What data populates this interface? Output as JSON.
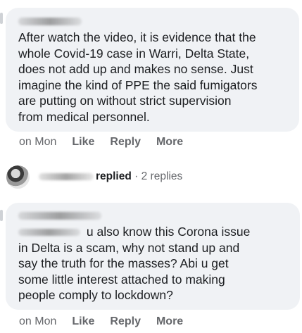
{
  "comment1": {
    "author": "N... Og...",
    "text": "After watch the video, it is evidence that the\nwhole Covid-19 case in Warri, Delta State,\ndoes not add up and makes no sense. Just\nimagine the kind of PPE the said fumigators\nare putting on without strict supervision\nfrom medical personnel.",
    "time": "on Mon",
    "like": "Like",
    "reply": "Reply",
    "more": "More"
  },
  "replies_summary": {
    "name": "...Og...no",
    "replied": "replied",
    "separator": "·",
    "count": "2 replies"
  },
  "comment2": {
    "author": "...ope",
    "mention": "S... ...ice",
    "text": " u also know this Corona issue\nin Delta is a scam, why not stand up and\nsay the truth for the masses? Abi u get\nsome little interest attached to making\npeople comply to lockdown?",
    "time": "on Mon",
    "like": "Like",
    "reply": "Reply",
    "more": "More"
  },
  "colors": {
    "bubble": "#f0f2f5",
    "text": "#1c1e21",
    "meta": "#65676b"
  }
}
